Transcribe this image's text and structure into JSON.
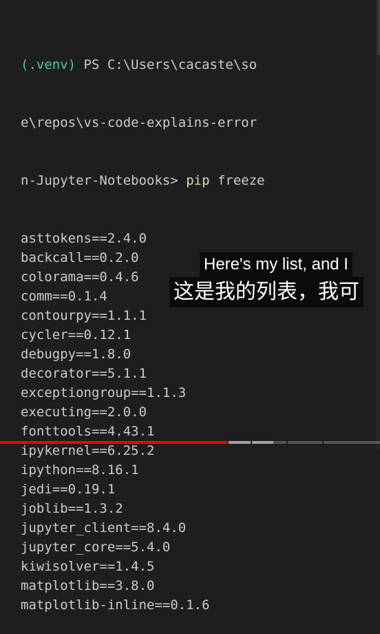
{
  "terminal": {
    "prompt_lines": [
      {
        "venv": "(.venv)",
        "rest": " PS C:\\Users\\cacaste\\so"
      },
      {
        "venv": "",
        "rest": "e\\repos\\vs-code-explains-error"
      },
      {
        "venv": "",
        "rest": "n-Jupyter-Notebooks> "
      }
    ],
    "command": "pip",
    "argument": " freeze",
    "packages": [
      "asttokens==2.4.0",
      "backcall==0.2.0",
      "colorama==0.4.6",
      "comm==0.1.4",
      "contourpy==1.1.1",
      "cycler==0.12.1",
      "debugpy==1.8.0",
      "decorator==5.1.1",
      "exceptiongroup==1.1.3",
      "executing==2.0.0",
      "fonttools==4.43.1",
      "ipykernel==6.25.2",
      "ipython==8.16.1",
      "jedi==0.19.1",
      "joblib==1.3.2",
      "jupyter_client==8.4.0",
      "jupyter_core==5.4.0",
      "kiwisolver==1.4.5",
      "matplotlib==3.8.0",
      "matplotlib-inline==0.1.6"
    ]
  },
  "subtitles": {
    "english": "Here's my list, and I",
    "chinese": "这是我的列表，我可"
  },
  "video_player": {
    "progress_fraction": 0.6,
    "buffered_fraction": 0.12
  },
  "colors": {
    "background": "#1e1e1e",
    "venv": "#4ec9b0",
    "command": "#dcdcaa",
    "text": "#cccccc",
    "progress": "#ff0000"
  }
}
